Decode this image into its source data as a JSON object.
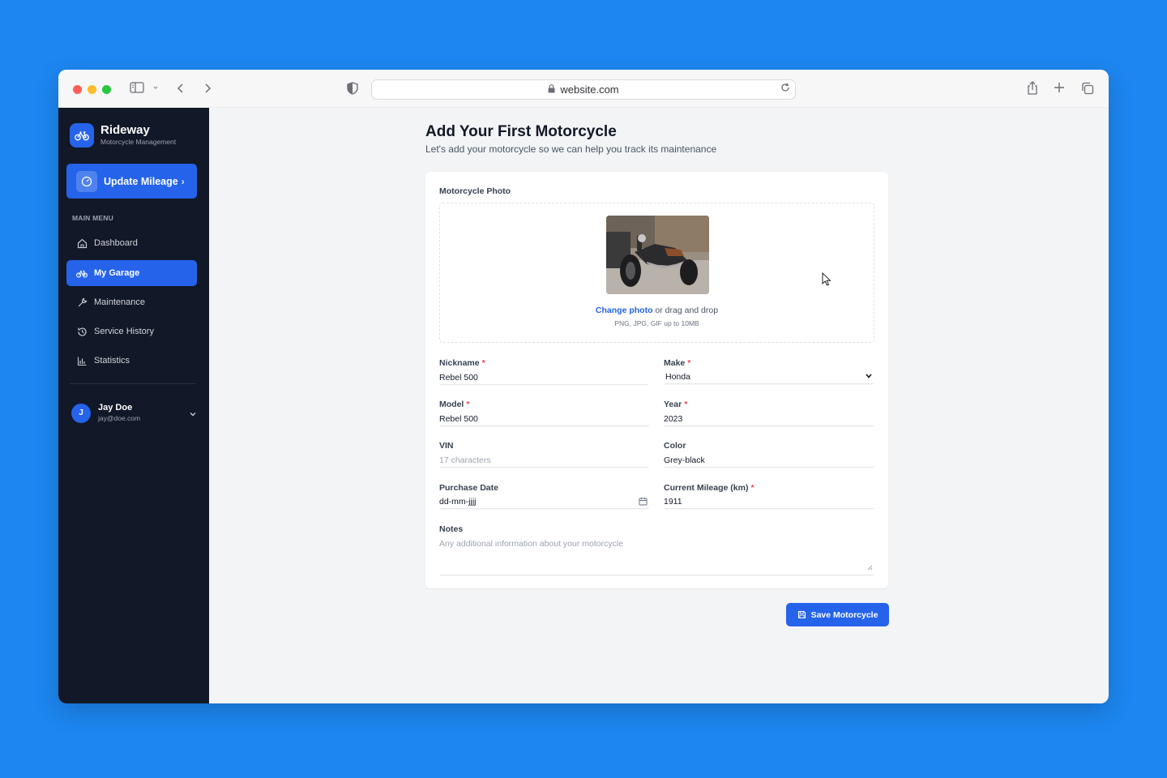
{
  "browser": {
    "url": "website.com"
  },
  "sidebar": {
    "brand_name": "Rideway",
    "brand_subtitle": "Motorcycle Management",
    "update_mileage_label": "Update Mileage",
    "menu_title": "MAIN MENU",
    "items": [
      {
        "label": "Dashboard",
        "icon": "home-icon",
        "active": false
      },
      {
        "label": "My Garage",
        "icon": "bicycle-icon",
        "active": true
      },
      {
        "label": "Maintenance",
        "icon": "wrench-icon",
        "active": false
      },
      {
        "label": "Service History",
        "icon": "history-icon",
        "active": false
      },
      {
        "label": "Statistics",
        "icon": "bar-chart-icon",
        "active": false
      }
    ],
    "user": {
      "initial": "J",
      "name": "Jay Doe",
      "email": "jay@doe.com"
    }
  },
  "main": {
    "title": "Add Your First Motorcycle",
    "subtitle": "Let's add your motorcycle so we can help you track its maintenance",
    "photo_label": "Motorcycle Photo",
    "change_photo_link": "Change photo",
    "drag_drop_text": " or drag and drop",
    "upload_hint": "PNG, JPG, GIF up to 10MB",
    "fields": {
      "nickname": {
        "label": "Nickname",
        "required": true,
        "value": "Rebel 500"
      },
      "make": {
        "label": "Make",
        "required": true,
        "value": "Honda"
      },
      "model": {
        "label": "Model",
        "required": true,
        "value": "Rebel 500"
      },
      "year": {
        "label": "Year",
        "required": true,
        "value": "2023"
      },
      "vin": {
        "label": "VIN",
        "required": false,
        "value": "",
        "placeholder": "17 characters"
      },
      "color": {
        "label": "Color",
        "required": false,
        "value": "Grey-black"
      },
      "purchase_date": {
        "label": "Purchase Date",
        "required": false,
        "value": "dd-mm-jjjj"
      },
      "mileage": {
        "label": "Current Mileage (km)",
        "required": true,
        "value": "1911"
      },
      "notes": {
        "label": "Notes",
        "required": false,
        "value": "",
        "placeholder": "Any additional information about your motorcycle"
      }
    },
    "save_label": "Save Motorcycle"
  },
  "colors": {
    "background": "#1d86f0",
    "sidebar": "#111827",
    "accent": "#2563eb",
    "required": "#ef4444"
  }
}
